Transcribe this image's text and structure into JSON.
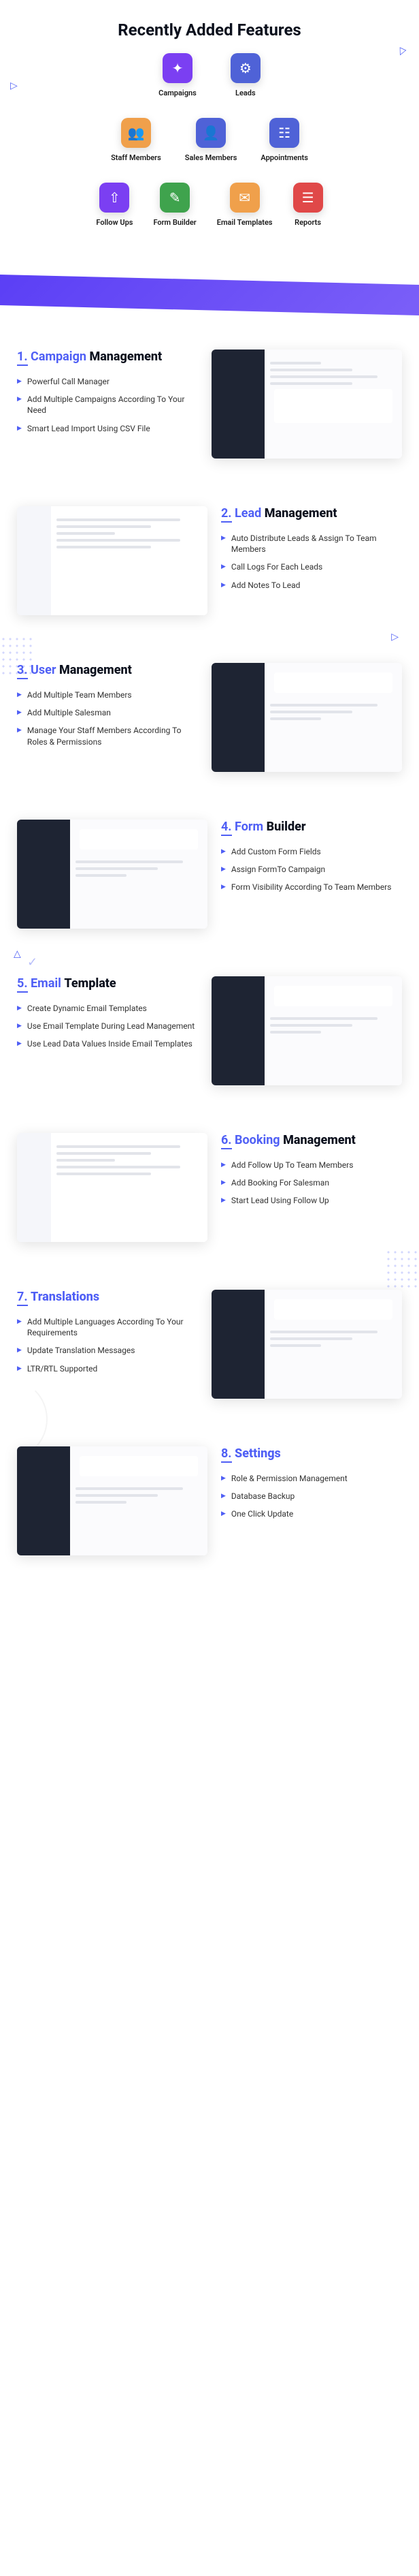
{
  "pageTitle": "Recently Added Features",
  "features": {
    "row1": [
      {
        "label": "Campaigns",
        "color": "icon-purple",
        "glyph": "✦"
      },
      {
        "label": "Leads",
        "color": "icon-blue",
        "glyph": "⚙"
      }
    ],
    "row2": [
      {
        "label": "Staff Members",
        "color": "icon-orange",
        "glyph": "👥"
      },
      {
        "label": "Sales Members",
        "color": "icon-blue",
        "glyph": "👤"
      },
      {
        "label": "Appointments",
        "color": "icon-blue",
        "glyph": "☷"
      }
    ],
    "row3": [
      {
        "label": "Follow Ups",
        "color": "icon-purple",
        "glyph": "⇧"
      },
      {
        "label": "Form Builder",
        "color": "icon-green",
        "glyph": "✎"
      },
      {
        "label": "Email Templates",
        "color": "icon-orange",
        "glyph": "✉"
      },
      {
        "label": "Reports",
        "color": "icon-red",
        "glyph": "☰"
      }
    ]
  },
  "sections": [
    {
      "num": "1.",
      "titlePrefix": "Campaign",
      "titleSuffix": "Management",
      "bullets": [
        "Powerful Call Manager",
        "Add Multiple Campaigns According To Your Need",
        "Smart Lead Import Using CSV File"
      ],
      "reverse": false,
      "mockup": "dark"
    },
    {
      "num": "2.",
      "titlePrefix": "Lead",
      "titleSuffix": "Management",
      "bullets": [
        "Auto Distribute Leads & Assign To Team Members",
        "Call Logs For Each Leads",
        "Add Notes To Lead"
      ],
      "reverse": true,
      "mockup": "light"
    },
    {
      "num": "3.",
      "titlePrefix": "User",
      "titleSuffix": "Management",
      "bullets": [
        "Add Multiple Team Members",
        "Add Multiple Salesman",
        "Manage Your Staff Members According To Roles & Permissions"
      ],
      "reverse": false,
      "mockup": "dark2"
    },
    {
      "num": "4.",
      "titlePrefix": "Form",
      "titleSuffix": "Builder",
      "bullets": [
        "Add Custom Form Fields",
        "Assign FormTo Campaign",
        "Form Visibility According To Team Members"
      ],
      "reverse": true,
      "mockup": "dark3"
    },
    {
      "num": "5.",
      "titlePrefix": "Email",
      "titleSuffix": "Template",
      "bullets": [
        "Create Dynamic Email Templates",
        "Use Email Template During Lead Management",
        "Use Lead Data Values Inside Email Templates"
      ],
      "reverse": false,
      "mockup": "dark2"
    },
    {
      "num": "6.",
      "titlePrefix": "Booking",
      "titleSuffix": "Management",
      "bullets": [
        "Add Follow Up To Team Members",
        "Add Booking For Salesman",
        "Start Lead Using Follow Up"
      ],
      "reverse": true,
      "mockup": "light2"
    },
    {
      "num": "7.",
      "titlePrefix": "Translations",
      "titleSuffix": "",
      "bullets": [
        "Add Multiple Languages According To Your Requirements",
        "Update Translation Messages",
        "LTR/RTL Supported"
      ],
      "reverse": false,
      "mockup": "dark2"
    },
    {
      "num": "8.",
      "titlePrefix": "Settings",
      "titleSuffix": "",
      "bullets": [
        "Role & Permission Management",
        "Database Backup",
        "One Click Update"
      ],
      "reverse": true,
      "mockup": "dark3"
    }
  ]
}
